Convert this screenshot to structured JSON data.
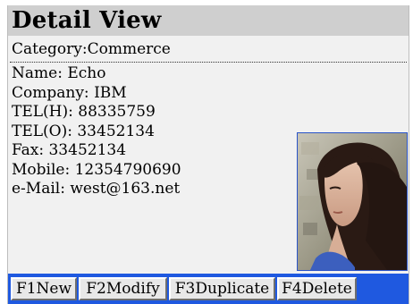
{
  "header": {
    "title": "Detail View"
  },
  "category": "Category:Commerce",
  "fields": [
    "Name: Echo",
    "Company: IBM",
    "TEL(H): 88335759",
    "TEL(O): 33452134",
    "Fax: 33452134",
    "Mobile: 12354790690",
    "e-Mail: west@163.net"
  ],
  "toolbar": {
    "new_label": "F1New",
    "modify_label": "F2Modify",
    "duplicate_label": "F3Duplicate",
    "delete_label": "F4Delete"
  },
  "colors": {
    "toolbar": "#1f59e0",
    "title_bar": "#cfcfcf",
    "background": "#f1f1f1"
  }
}
